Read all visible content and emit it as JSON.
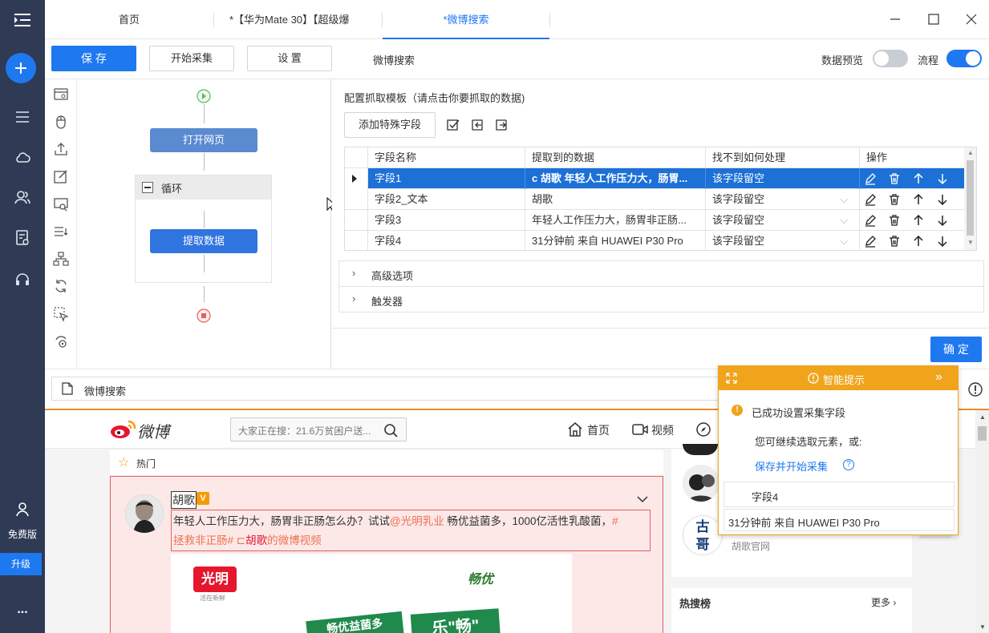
{
  "tabs": [
    {
      "label": "首页"
    },
    {
      "label": "*【华为Mate 30】【超级爆"
    },
    {
      "label": "*微博搜索"
    }
  ],
  "sidebar": {
    "free_label": "免费版",
    "upgrade_label": "升级",
    "more_label": "..."
  },
  "toolbar": {
    "save": "保 存",
    "start": "开始采集",
    "settings": "设 置",
    "task_name": "微博搜索",
    "preview_label": "数据预览",
    "flow_label": "流程"
  },
  "flow": {
    "open_page": "打开网页",
    "loop": "循环",
    "extract": "提取数据"
  },
  "config": {
    "title": "配置抓取模板（请点击你要抓取的数据)",
    "add_field": "添加特殊字段",
    "headers": [
      "字段名称",
      "提取到的数据",
      "找不到如何处理",
      "操作"
    ],
    "rows": [
      {
        "name": "字段1",
        "data": "c 胡歌 年轻人工作压力大，肠胃...",
        "fallback": "该字段留空"
      },
      {
        "name": "字段2_文本",
        "data": "胡歌",
        "fallback": "该字段留空"
      },
      {
        "name": "字段3",
        "data": "年轻人工作压力大，肠胃非正肠...",
        "fallback": "该字段留空"
      },
      {
        "name": "字段4",
        "data": "31分钟前  来自 HUAWEI P30 Pro",
        "fallback": "该字段留空"
      }
    ],
    "advanced": "高级选项",
    "trigger": "触发器",
    "confirm": "确 定"
  },
  "address": {
    "url": "微博搜索"
  },
  "weibo": {
    "logo_text": "微博",
    "search_placeholder": "大家正在搜：21.6万贫困户送...",
    "nav_home": "首页",
    "nav_video": "视频",
    "hot_label": "热门",
    "user_name": "胡歌",
    "post_text_1": "年轻人工作压力大，肠胃非正肠怎么办？试试",
    "post_mention": "@光明乳业",
    "post_text_2": " 畅优益菌多，1000亿活性乳酸菌，",
    "post_tag_1": "#",
    "post_tag_2": "拯救非正肠#",
    "post_video_prefix": " ⊏",
    "post_video_user": "胡歌",
    "post_video_suffix": "的微博视频",
    "ad_brand": "光明",
    "ad_brand_sub": "活在新鲜",
    "ad_brand2": "畅优",
    "ad_banner_1": "畅优益菌多",
    "ad_banner_2": "乐\"畅\"",
    "side_name": "胡歌官网",
    "hot_search_title": "热搜榜",
    "more_label": "更多 ›"
  },
  "tip": {
    "header": "智能提示",
    "success": "已成功设置采集字段",
    "continue": "您可继续选取元素，或:",
    "link": "保存并开始采集",
    "field_name": "字段4",
    "field_value": "31分钟前  来自 HUAWEI P30 Pro"
  },
  "colors": {
    "sidebar_bg": "#2f3a55",
    "accent": "#1e78f0",
    "selection": "#1c70d6",
    "tip_orange": "#f0a41c"
  }
}
